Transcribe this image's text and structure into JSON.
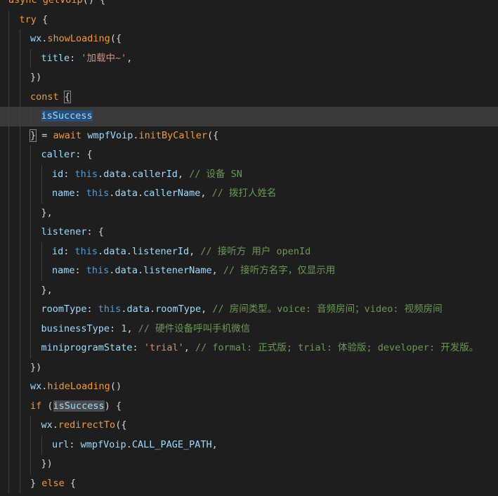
{
  "editor": {
    "lines": [
      {
        "indent": 0,
        "tokens": [
          {
            "t": "async",
            "c": "fn-orange"
          },
          {
            "t": " ",
            "c": "punc"
          },
          {
            "t": "getVoip",
            "c": "fn-orange"
          },
          {
            "t": "() {",
            "c": "punc"
          }
        ]
      },
      {
        "indent": 1,
        "tokens": [
          {
            "t": "try",
            "c": "kw-orange"
          },
          {
            "t": " {",
            "c": "punc"
          }
        ]
      },
      {
        "indent": 2,
        "tokens": [
          {
            "t": "wx",
            "c": "var"
          },
          {
            "t": ".",
            "c": "punc"
          },
          {
            "t": "showLoading",
            "c": "fn-orange"
          },
          {
            "t": "({",
            "c": "punc"
          }
        ]
      },
      {
        "indent": 3,
        "tokens": [
          {
            "t": "title",
            "c": "prop"
          },
          {
            "t": ": ",
            "c": "punc"
          },
          {
            "t": "'加载中~'",
            "c": "str"
          },
          {
            "t": ",",
            "c": "punc"
          }
        ]
      },
      {
        "indent": 2,
        "tokens": [
          {
            "t": "})",
            "c": "punc"
          }
        ]
      },
      {
        "indent": 2,
        "tokens": [
          {
            "t": "const",
            "c": "kw-orange"
          },
          {
            "t": " ",
            "c": "punc"
          },
          {
            "t": "{",
            "c": "punc brace-hl"
          }
        ]
      },
      {
        "indent": 3,
        "current": true,
        "tokens": [
          {
            "t": "isSuccess",
            "c": "var sel-hl"
          }
        ]
      },
      {
        "indent": 2,
        "tokens": [
          {
            "t": "}",
            "c": "punc brace-hl"
          },
          {
            "t": " = ",
            "c": "punc"
          },
          {
            "t": "await",
            "c": "kw-orange"
          },
          {
            "t": " ",
            "c": "punc"
          },
          {
            "t": "wmpfVoip",
            "c": "var"
          },
          {
            "t": ".",
            "c": "punc"
          },
          {
            "t": "initByCaller",
            "c": "fn-orange"
          },
          {
            "t": "({",
            "c": "punc"
          }
        ]
      },
      {
        "indent": 3,
        "tokens": [
          {
            "t": "caller",
            "c": "prop"
          },
          {
            "t": ": {",
            "c": "punc"
          }
        ]
      },
      {
        "indent": 4,
        "tokens": [
          {
            "t": "id",
            "c": "prop"
          },
          {
            "t": ": ",
            "c": "punc"
          },
          {
            "t": "this",
            "c": "kw"
          },
          {
            "t": ".",
            "c": "punc"
          },
          {
            "t": "data",
            "c": "var"
          },
          {
            "t": ".",
            "c": "punc"
          },
          {
            "t": "callerId",
            "c": "var"
          },
          {
            "t": ", ",
            "c": "punc"
          },
          {
            "t": "// 设备 SN",
            "c": "cmt"
          }
        ]
      },
      {
        "indent": 4,
        "tokens": [
          {
            "t": "name",
            "c": "prop"
          },
          {
            "t": ": ",
            "c": "punc"
          },
          {
            "t": "this",
            "c": "kw"
          },
          {
            "t": ".",
            "c": "punc"
          },
          {
            "t": "data",
            "c": "var"
          },
          {
            "t": ".",
            "c": "punc"
          },
          {
            "t": "callerName",
            "c": "var"
          },
          {
            "t": ", ",
            "c": "punc"
          },
          {
            "t": "// 拨打人姓名",
            "c": "cmt"
          }
        ]
      },
      {
        "indent": 3,
        "tokens": [
          {
            "t": "},",
            "c": "punc"
          }
        ]
      },
      {
        "indent": 3,
        "tokens": [
          {
            "t": "listener",
            "c": "prop"
          },
          {
            "t": ": {",
            "c": "punc"
          }
        ]
      },
      {
        "indent": 4,
        "tokens": [
          {
            "t": "id",
            "c": "prop"
          },
          {
            "t": ": ",
            "c": "punc"
          },
          {
            "t": "this",
            "c": "kw"
          },
          {
            "t": ".",
            "c": "punc"
          },
          {
            "t": "data",
            "c": "var"
          },
          {
            "t": ".",
            "c": "punc"
          },
          {
            "t": "listenerId",
            "c": "var"
          },
          {
            "t": ", ",
            "c": "punc"
          },
          {
            "t": "// 接听方 用户 openId",
            "c": "cmt"
          }
        ]
      },
      {
        "indent": 4,
        "tokens": [
          {
            "t": "name",
            "c": "prop"
          },
          {
            "t": ": ",
            "c": "punc"
          },
          {
            "t": "this",
            "c": "kw"
          },
          {
            "t": ".",
            "c": "punc"
          },
          {
            "t": "data",
            "c": "var"
          },
          {
            "t": ".",
            "c": "punc"
          },
          {
            "t": "listenerName",
            "c": "var"
          },
          {
            "t": ", ",
            "c": "punc"
          },
          {
            "t": "// 接听方名字，仅显示用",
            "c": "cmt"
          }
        ]
      },
      {
        "indent": 3,
        "tokens": [
          {
            "t": "},",
            "c": "punc"
          }
        ]
      },
      {
        "indent": 3,
        "tokens": [
          {
            "t": "roomType",
            "c": "prop"
          },
          {
            "t": ": ",
            "c": "punc"
          },
          {
            "t": "this",
            "c": "kw"
          },
          {
            "t": ".",
            "c": "punc"
          },
          {
            "t": "data",
            "c": "var"
          },
          {
            "t": ".",
            "c": "punc"
          },
          {
            "t": "roomType",
            "c": "var"
          },
          {
            "t": ", ",
            "c": "punc"
          },
          {
            "t": "// 房间类型。voice: 音频房间；video: 视频房间",
            "c": "cmt"
          }
        ]
      },
      {
        "indent": 3,
        "tokens": [
          {
            "t": "businessType",
            "c": "prop"
          },
          {
            "t": ": ",
            "c": "punc"
          },
          {
            "t": "1",
            "c": "num"
          },
          {
            "t": ", ",
            "c": "punc"
          },
          {
            "t": "// 硬件设备呼叫手机微信",
            "c": "cmt"
          }
        ]
      },
      {
        "indent": 3,
        "tokens": [
          {
            "t": "miniprogramState",
            "c": "prop"
          },
          {
            "t": ": ",
            "c": "punc"
          },
          {
            "t": "'trial'",
            "c": "str"
          },
          {
            "t": ", ",
            "c": "punc"
          },
          {
            "t": "// formal: 正式版; trial: 体验版; developer: 开发版。",
            "c": "cmt"
          }
        ]
      },
      {
        "indent": 2,
        "tokens": [
          {
            "t": "})",
            "c": "punc"
          }
        ]
      },
      {
        "indent": 2,
        "tokens": [
          {
            "t": "wx",
            "c": "var"
          },
          {
            "t": ".",
            "c": "punc"
          },
          {
            "t": "hideLoading",
            "c": "fn-orange"
          },
          {
            "t": "()",
            "c": "punc"
          }
        ]
      },
      {
        "indent": 2,
        "tokens": [
          {
            "t": "if",
            "c": "kw-orange"
          },
          {
            "t": " (",
            "c": "punc"
          },
          {
            "t": "isSuccess",
            "c": "var occ-hl"
          },
          {
            "t": ") {",
            "c": "punc"
          }
        ]
      },
      {
        "indent": 3,
        "tokens": [
          {
            "t": "wx",
            "c": "var"
          },
          {
            "t": ".",
            "c": "punc"
          },
          {
            "t": "redirectTo",
            "c": "fn-orange"
          },
          {
            "t": "({",
            "c": "punc"
          }
        ]
      },
      {
        "indent": 4,
        "tokens": [
          {
            "t": "url",
            "c": "prop"
          },
          {
            "t": ": ",
            "c": "punc"
          },
          {
            "t": "wmpfVoip",
            "c": "var"
          },
          {
            "t": ".",
            "c": "punc"
          },
          {
            "t": "CALL_PAGE_PATH",
            "c": "var"
          },
          {
            "t": ",",
            "c": "punc"
          }
        ]
      },
      {
        "indent": 3,
        "tokens": [
          {
            "t": "})",
            "c": "punc"
          }
        ]
      },
      {
        "indent": 2,
        "tokens": [
          {
            "t": "} ",
            "c": "punc"
          },
          {
            "t": "else",
            "c": "kw-orange"
          },
          {
            "t": " {",
            "c": "punc"
          }
        ]
      }
    ]
  }
}
